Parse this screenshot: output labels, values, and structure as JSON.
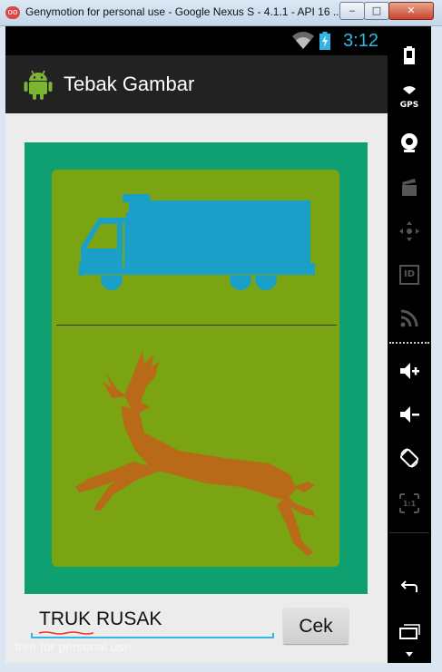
{
  "window": {
    "logo": "oo",
    "title": "Genymotion for personal use - Google Nexus S - 4.1.1 - API 16 ...",
    "min_glyph": "‒",
    "max_glyph": "□",
    "close_glyph": "✕"
  },
  "statusbar": {
    "time": "3:12",
    "accent": "#33b5e5"
  },
  "app": {
    "title": "Tebak Gambar",
    "icon": "android-icon"
  },
  "puzzle": {
    "colors": {
      "frame": "#0fa072",
      "panel": "#7aa411",
      "truck": "#1aa0c8",
      "deer": "#b86a18"
    },
    "top_picture": "truck-icon",
    "bottom_picture": "deer-icon"
  },
  "answer": {
    "value": "TRUK RUSAK"
  },
  "check_button": {
    "label": "Cek"
  },
  "watermark": "free for personal use",
  "sidebar": {
    "items": [
      {
        "icon": "battery-icon"
      },
      {
        "icon": "gps-icon",
        "label": "GPS"
      },
      {
        "icon": "camera-icon"
      },
      {
        "icon": "video-capture-icon"
      },
      {
        "icon": "dpad-icon"
      },
      {
        "icon": "id-icon",
        "label": "ID"
      },
      {
        "icon": "rss-icon"
      },
      {
        "icon": "volume-up-icon"
      },
      {
        "icon": "volume-down-icon"
      },
      {
        "icon": "rotate-icon"
      },
      {
        "icon": "pixel-perfect-icon",
        "label": "1:1"
      },
      {
        "icon": "back-icon"
      },
      {
        "icon": "recent-apps-icon"
      },
      {
        "icon": "menu-down-icon"
      }
    ]
  }
}
